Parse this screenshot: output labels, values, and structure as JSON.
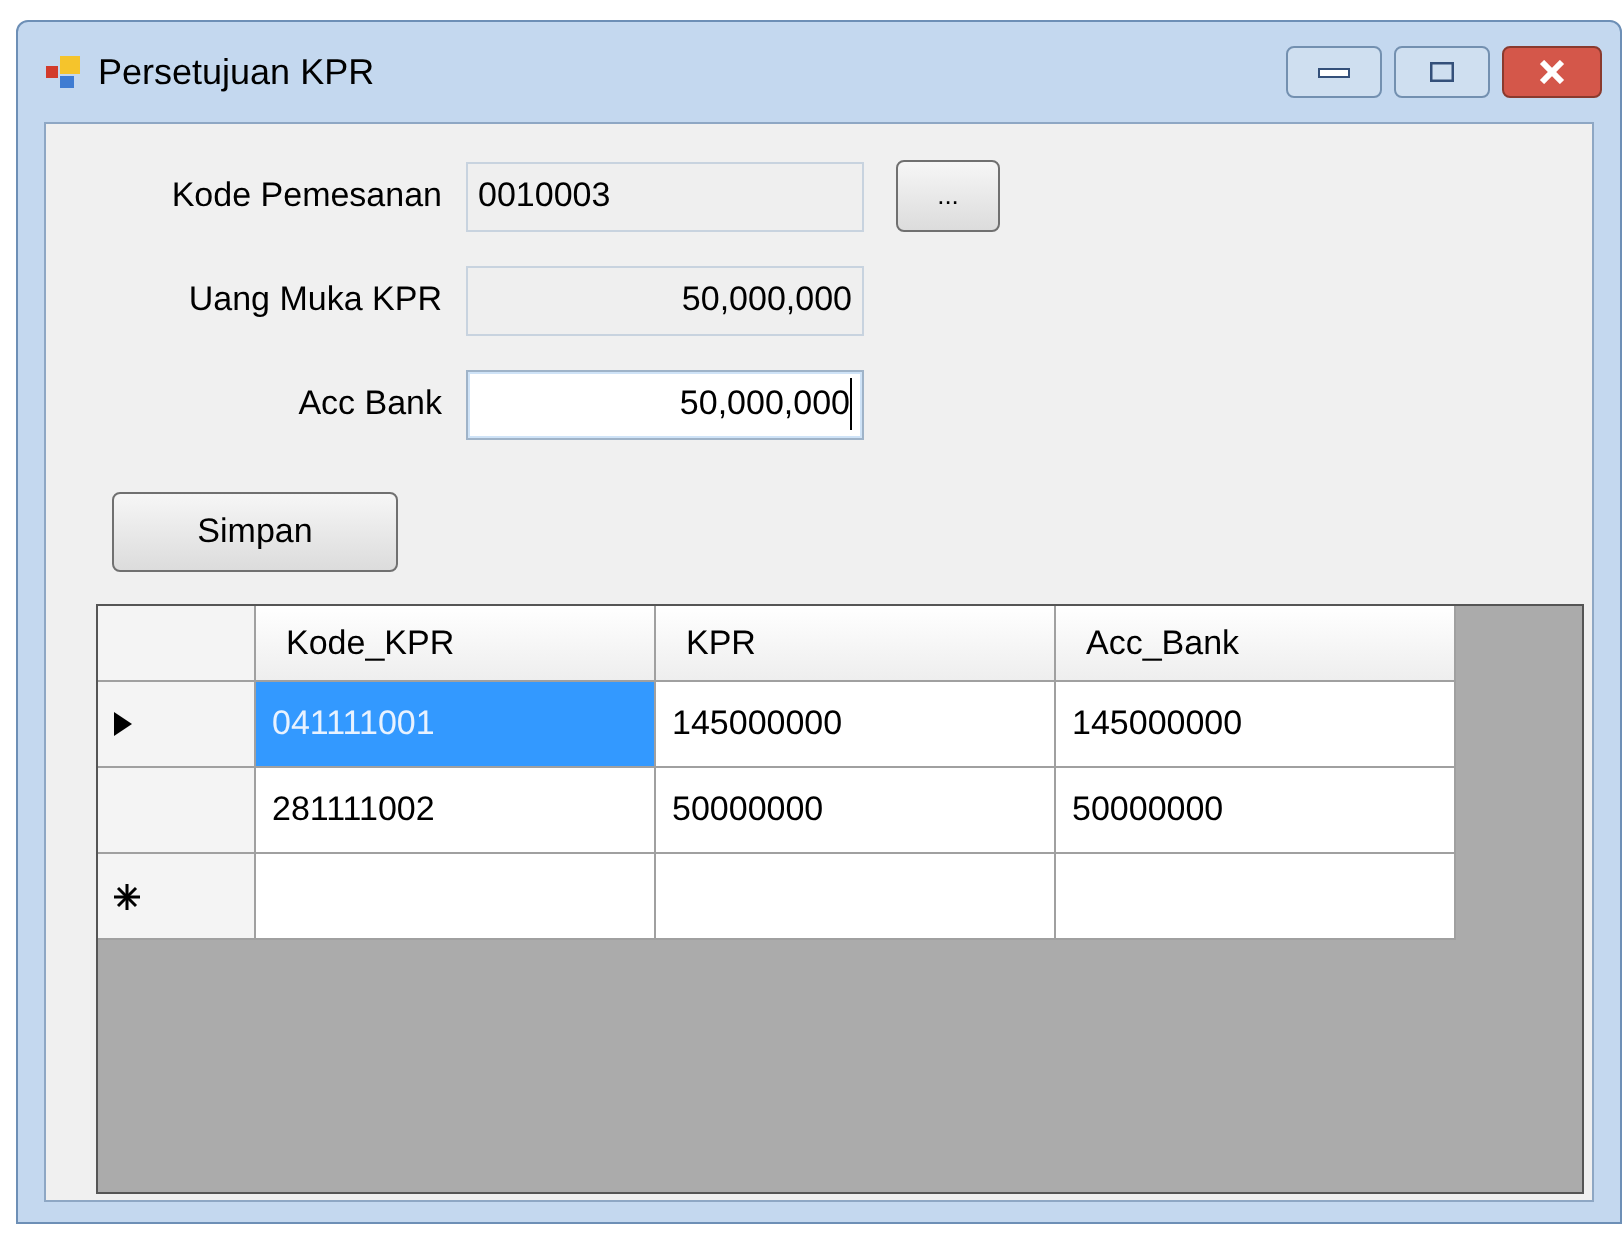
{
  "window": {
    "title": "Persetujuan KPR"
  },
  "fields": [
    {
      "kind": "code",
      "label": "Kode Pemesanan",
      "value": "0010003",
      "readonly": true,
      "focused": false
    },
    {
      "kind": "amount",
      "label": "Uang Muka KPR",
      "value": "50,000,000",
      "readonly": true,
      "focused": false
    },
    {
      "kind": "amount",
      "label": "Acc Bank",
      "value": "50,000,000",
      "readonly": false,
      "focused": true
    }
  ],
  "browse_button": "...",
  "save_button": "Simpan",
  "grid": {
    "columns": [
      "Kode_KPR",
      "KPR",
      "Acc_Bank"
    ],
    "rows": [
      {
        "kind": "current",
        "cells": [
          {
            "text": "041111001",
            "selected": true
          },
          {
            "text": "145000000",
            "selected": false
          },
          {
            "text": "145000000",
            "selected": false
          }
        ]
      },
      {
        "kind": "plain",
        "cells": [
          {
            "text": "281111002",
            "selected": false
          },
          {
            "text": "50000000",
            "selected": false
          },
          {
            "text": "50000000",
            "selected": false
          }
        ]
      },
      {
        "kind": "new",
        "cells": [
          {
            "text": "",
            "selected": false
          },
          {
            "text": "",
            "selected": false
          },
          {
            "text": "",
            "selected": false
          }
        ]
      }
    ]
  }
}
